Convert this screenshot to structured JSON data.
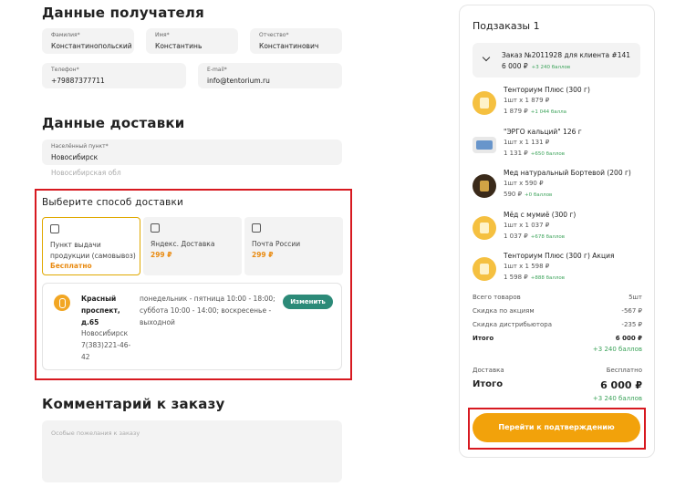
{
  "recipient": {
    "title": "Данные получателя",
    "surname_label": "Фамилия*",
    "surname": "Константинопольский",
    "name_label": "Имя*",
    "name": "Константинь",
    "patronymic_label": "Отчество*",
    "patronymic": "Константинович",
    "phone_label": "Телефон*",
    "phone": "+79887377711",
    "email_label": "E-mail*",
    "email": "info@tentorium.ru"
  },
  "delivery": {
    "title": "Данные доставки",
    "city_label": "Населённый пункт*",
    "city": "Новосибирск",
    "region": "Новосибирская обл",
    "method_title": "Выберите способ доставки",
    "options": [
      {
        "name": "Пункт выдачи продукции (самовывоз)",
        "price": "Бесплатно"
      },
      {
        "name": "Яндекс. Доставка",
        "price": "299 ₽"
      },
      {
        "name": "Почта России",
        "price": "299 ₽"
      }
    ],
    "pickup": {
      "address": "Красный проспект, д.65",
      "city": "Новосибирск",
      "phone": "7(383)221-46-42",
      "hours": "понедельник - пятница 10:00 - 18:00; суббота 10:00 - 14:00; воскресенье - выходной",
      "change_label": "Изменить"
    }
  },
  "comment": {
    "title": "Комментарий к заказу",
    "placeholder": "Особые пожелания к заказу"
  },
  "summary": {
    "title": "Подзаказы 1",
    "order_title": "Заказ №2011928 для клиента #141",
    "order_sum": "6 000 ₽",
    "order_points": "+3 240 баллов",
    "items": [
      {
        "name": "Тенториум Плюс (300 г)",
        "qty": "1шт x 1 879 ₽",
        "price": "1 879 ₽",
        "points": "+1 044 балла"
      },
      {
        "name": "\"ЭРГО кальций\" 126 г",
        "qty": "1шт x 1 131 ₽",
        "price": "1 131 ₽",
        "points": "+650 баллов"
      },
      {
        "name": "Мед натуральный Бортевой (200 г)",
        "qty": "1шт x 590 ₽",
        "price": "590 ₽",
        "points": "+0 баллов"
      },
      {
        "name": "Мёд с мумиё (300 г)",
        "qty": "1шт x 1 037 ₽",
        "price": "1 037 ₽",
        "points": "+678 баллов"
      },
      {
        "name": "Тенториум Плюс (300 г) Акция",
        "qty": "1шт x 1 598 ₽",
        "price": "1 598 ₽",
        "points": "+888 баллов"
      }
    ],
    "total_items_label": "Всего товаров",
    "total_items": "5шт",
    "promo_label": "Скидка по акциям",
    "promo": "-567 ₽",
    "dist_label": "Скидка дистрибьютора",
    "dist": "-235 ₽",
    "subtotal_label": "Итого",
    "subtotal": "6 000 ₽",
    "subtotal_points": "+3 240 баллов",
    "delivery_label": "Доставка",
    "delivery": "Бесплатно",
    "total_label": "Итого",
    "total": "6 000 ₽",
    "total_points": "+3 240 баллов",
    "confirm_label": "Перейти к подтверждению"
  }
}
